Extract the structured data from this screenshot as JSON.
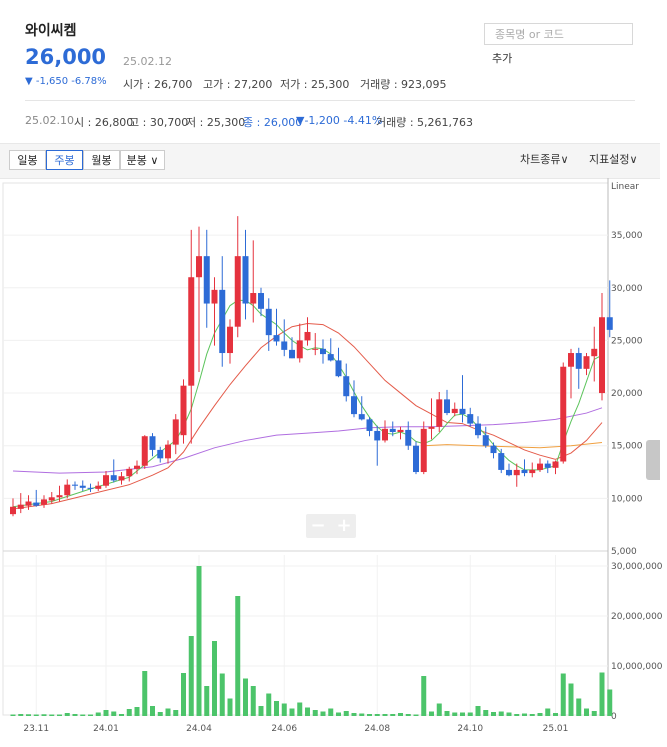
{
  "stock": {
    "name": "와이씨켐",
    "price": "26,000",
    "date": "25.02.12",
    "change": "▼ -1,650 -6.78%",
    "open": "시가 : 26,700",
    "high": "고가 : 27,200",
    "low": "저가 : 25,300",
    "volume": "거래량 : 923,095"
  },
  "search": {
    "placeholder": "종목명 or 코드",
    "add_label": "추가"
  },
  "prev_week": {
    "date": "25.02.10",
    "open": "시 : 26,800",
    "high": "고 : 30,700",
    "low": "저 : 25,300",
    "close": "종 : 26,000",
    "change": "▼-1,200 -4.41%",
    "volume": "거래량 : 5,261,763"
  },
  "toolbar": {
    "daily": "일봉",
    "weekly": "주봉",
    "monthly": "월봉",
    "minute": "분봉 ∨",
    "chart_type": "차트종류∨",
    "indicator": "지표설정∨"
  },
  "colors": {
    "up": "#e5323e",
    "down": "#2d6bd6",
    "volume": "#4cc46a",
    "ma5": "#5cc45c",
    "ma20": "#e45b4a",
    "ma60": "#f0a040",
    "ma120": "#b06ee0"
  },
  "chart_data": {
    "type": "candlestick",
    "scale_label": "Linear",
    "price_ticks": [
      5000,
      10000,
      15000,
      20000,
      25000,
      30000,
      35000
    ],
    "price_tick_labels": [
      "5,000",
      "10,000",
      "15,000",
      "20,000",
      "25,000",
      "30,000",
      "35,000"
    ],
    "volume_ticks": [
      0,
      10000000,
      20000000,
      30000000
    ],
    "volume_tick_labels": [
      "0",
      "10,000,000",
      "20,000,000",
      "30,000,000"
    ],
    "x_labels": [
      {
        "i": 3,
        "label": "23.11"
      },
      {
        "i": 12,
        "label": "24.01"
      },
      {
        "i": 24,
        "label": "24.04"
      },
      {
        "i": 35,
        "label": "24.06"
      },
      {
        "i": 47,
        "label": "24.08"
      },
      {
        "i": 59,
        "label": "24.10"
      },
      {
        "i": 70,
        "label": "25.01"
      }
    ],
    "candles": [
      {
        "o": 8500,
        "h": 10000,
        "l": 8300,
        "c": 9200,
        "v": 300000
      },
      {
        "o": 9000,
        "h": 10500,
        "l": 8600,
        "c": 9400,
        "v": 400000
      },
      {
        "o": 9300,
        "h": 10300,
        "l": 8900,
        "c": 9700,
        "v": 350000
      },
      {
        "o": 9600,
        "h": 10800,
        "l": 9200,
        "c": 9300,
        "v": 300000
      },
      {
        "o": 9400,
        "h": 10300,
        "l": 9100,
        "c": 9900,
        "v": 350000
      },
      {
        "o": 9800,
        "h": 10600,
        "l": 9500,
        "c": 10100,
        "v": 300000
      },
      {
        "o": 10100,
        "h": 11200,
        "l": 9700,
        "c": 10300,
        "v": 300000
      },
      {
        "o": 10300,
        "h": 11800,
        "l": 10000,
        "c": 11300,
        "v": 600000
      },
      {
        "o": 11300,
        "h": 11600,
        "l": 10800,
        "c": 11200,
        "v": 400000
      },
      {
        "o": 11200,
        "h": 11700,
        "l": 10700,
        "c": 11000,
        "v": 300000
      },
      {
        "o": 11000,
        "h": 11400,
        "l": 10600,
        "c": 10900,
        "v": 300000
      },
      {
        "o": 10900,
        "h": 11600,
        "l": 10700,
        "c": 11200,
        "v": 700000
      },
      {
        "o": 11200,
        "h": 12600,
        "l": 11000,
        "c": 12200,
        "v": 1200000
      },
      {
        "o": 12200,
        "h": 13700,
        "l": 11500,
        "c": 11700,
        "v": 900000
      },
      {
        "o": 11700,
        "h": 12500,
        "l": 11300,
        "c": 12100,
        "v": 400000
      },
      {
        "o": 12100,
        "h": 13000,
        "l": 11600,
        "c": 12800,
        "v": 1400000
      },
      {
        "o": 12800,
        "h": 13600,
        "l": 12300,
        "c": 13100,
        "v": 1800000
      },
      {
        "o": 13100,
        "h": 16000,
        "l": 12800,
        "c": 15900,
        "v": 9000000
      },
      {
        "o": 15900,
        "h": 16200,
        "l": 14000,
        "c": 14600,
        "v": 2000000
      },
      {
        "o": 14600,
        "h": 14900,
        "l": 13400,
        "c": 13800,
        "v": 800000
      },
      {
        "o": 13800,
        "h": 15500,
        "l": 13300,
        "c": 15100,
        "v": 1500000
      },
      {
        "o": 15100,
        "h": 18000,
        "l": 14200,
        "c": 17500,
        "v": 1200000
      },
      {
        "o": 16000,
        "h": 21300,
        "l": 15200,
        "c": 20700,
        "v": 8600000
      },
      {
        "o": 20700,
        "h": 35500,
        "l": 15200,
        "c": 31000,
        "v": 16000000
      },
      {
        "o": 31000,
        "h": 35800,
        "l": 22000,
        "c": 33000,
        "v": 30000000
      },
      {
        "o": 33000,
        "h": 35500,
        "l": 26200,
        "c": 28500,
        "v": 6000000
      },
      {
        "o": 28500,
        "h": 31000,
        "l": 24500,
        "c": 29800,
        "v": 15000000
      },
      {
        "o": 29800,
        "h": 33000,
        "l": 22500,
        "c": 23800,
        "v": 8500000
      },
      {
        "o": 23800,
        "h": 27000,
        "l": 22800,
        "c": 26300,
        "v": 3500000
      },
      {
        "o": 26300,
        "h": 36800,
        "l": 25300,
        "c": 33000,
        "v": 24000000
      },
      {
        "o": 33000,
        "h": 35500,
        "l": 27000,
        "c": 28500,
        "v": 7500000
      },
      {
        "o": 28500,
        "h": 34500,
        "l": 26700,
        "c": 29500,
        "v": 6000000
      },
      {
        "o": 29500,
        "h": 30000,
        "l": 27300,
        "c": 28000,
        "v": 2000000
      },
      {
        "o": 28000,
        "h": 29000,
        "l": 24000,
        "c": 25500,
        "v": 4500000
      },
      {
        "o": 25500,
        "h": 28000,
        "l": 24500,
        "c": 24900,
        "v": 3000000
      },
      {
        "o": 24900,
        "h": 27000,
        "l": 23500,
        "c": 24100,
        "v": 2500000
      },
      {
        "o": 24100,
        "h": 25300,
        "l": 23300,
        "c": 23300,
        "v": 1500000
      },
      {
        "o": 23300,
        "h": 26600,
        "l": 22900,
        "c": 25000,
        "v": 2700000
      },
      {
        "o": 25000,
        "h": 27200,
        "l": 24500,
        "c": 25800,
        "v": 1700000
      },
      {
        "o": 24200,
        "h": 25700,
        "l": 23600,
        "c": 24200,
        "v": 1200000
      },
      {
        "o": 24200,
        "h": 25100,
        "l": 22800,
        "c": 23700,
        "v": 900000
      },
      {
        "o": 23700,
        "h": 25200,
        "l": 23000,
        "c": 23100,
        "v": 1500000
      },
      {
        "o": 23100,
        "h": 24300,
        "l": 21500,
        "c": 21600,
        "v": 700000
      },
      {
        "o": 21600,
        "h": 22800,
        "l": 19200,
        "c": 19700,
        "v": 1000000
      },
      {
        "o": 19700,
        "h": 21200,
        "l": 17700,
        "c": 18000,
        "v": 600000
      },
      {
        "o": 18000,
        "h": 19700,
        "l": 17400,
        "c": 17500,
        "v": 500000
      },
      {
        "o": 17500,
        "h": 17700,
        "l": 15900,
        "c": 16400,
        "v": 400000
      },
      {
        "o": 16400,
        "h": 16900,
        "l": 13100,
        "c": 15500,
        "v": 400000
      },
      {
        "o": 15500,
        "h": 17400,
        "l": 15300,
        "c": 16600,
        "v": 400000
      },
      {
        "o": 16600,
        "h": 17300,
        "l": 15900,
        "c": 16300,
        "v": 400000
      },
      {
        "o": 16300,
        "h": 16800,
        "l": 15600,
        "c": 16500,
        "v": 600000
      },
      {
        "o": 16500,
        "h": 17300,
        "l": 14600,
        "c": 15000,
        "v": 400000
      },
      {
        "o": 15000,
        "h": 15400,
        "l": 12300,
        "c": 12500,
        "v": 300000
      },
      {
        "o": 12500,
        "h": 17300,
        "l": 12300,
        "c": 16600,
        "v": 8000000
      },
      {
        "o": 16600,
        "h": 19500,
        "l": 15600,
        "c": 16800,
        "v": 900000
      },
      {
        "o": 16800,
        "h": 20100,
        "l": 16300,
        "c": 19400,
        "v": 2500000
      },
      {
        "o": 19400,
        "h": 20300,
        "l": 17900,
        "c": 18100,
        "v": 1000000
      },
      {
        "o": 18100,
        "h": 19100,
        "l": 17800,
        "c": 18500,
        "v": 700000
      },
      {
        "o": 18500,
        "h": 21700,
        "l": 17200,
        "c": 18000,
        "v": 700000
      },
      {
        "o": 18000,
        "h": 18600,
        "l": 16800,
        "c": 17100,
        "v": 700000
      },
      {
        "o": 17100,
        "h": 17800,
        "l": 15700,
        "c": 16000,
        "v": 2000000
      },
      {
        "o": 16000,
        "h": 16800,
        "l": 14800,
        "c": 15000,
        "v": 1200000
      },
      {
        "o": 15000,
        "h": 15300,
        "l": 13800,
        "c": 14300,
        "v": 800000
      },
      {
        "o": 14300,
        "h": 14700,
        "l": 12400,
        "c": 12700,
        "v": 900000
      },
      {
        "o": 12700,
        "h": 13300,
        "l": 12100,
        "c": 12200,
        "v": 700000
      },
      {
        "o": 12200,
        "h": 13300,
        "l": 11100,
        "c": 12700,
        "v": 400000
      },
      {
        "o": 12700,
        "h": 13700,
        "l": 12100,
        "c": 12400,
        "v": 500000
      },
      {
        "o": 12400,
        "h": 13400,
        "l": 12000,
        "c": 12700,
        "v": 400000
      },
      {
        "o": 12700,
        "h": 13800,
        "l": 12500,
        "c": 13300,
        "v": 600000
      },
      {
        "o": 13300,
        "h": 13600,
        "l": 12400,
        "c": 12900,
        "v": 1500000
      },
      {
        "o": 12900,
        "h": 13600,
        "l": 12300,
        "c": 13500,
        "v": 600000
      },
      {
        "o": 13500,
        "h": 22900,
        "l": 13300,
        "c": 22500,
        "v": 8500000
      },
      {
        "o": 22500,
        "h": 24200,
        "l": 19500,
        "c": 23800,
        "v": 6500000
      },
      {
        "o": 23800,
        "h": 24300,
        "l": 20400,
        "c": 22300,
        "v": 3500000
      },
      {
        "o": 22300,
        "h": 23800,
        "l": 21700,
        "c": 23500,
        "v": 1500000
      },
      {
        "o": 23500,
        "h": 26300,
        "l": 21100,
        "c": 24200,
        "v": 1000000
      },
      {
        "o": 20000,
        "h": 29500,
        "l": 19300,
        "c": 27200,
        "v": 8700000
      },
      {
        "o": 27200,
        "h": 30700,
        "l": 25300,
        "c": 26000,
        "v": 5300000
      }
    ],
    "ma5": [
      [
        0,
        9200
      ],
      [
        5,
        9700
      ],
      [
        10,
        10900
      ],
      [
        15,
        12000
      ],
      [
        19,
        14400
      ],
      [
        21,
        15500
      ],
      [
        22,
        16800
      ],
      [
        23,
        18500
      ],
      [
        24,
        21000
      ],
      [
        25,
        23700
      ],
      [
        26,
        25700
      ],
      [
        27,
        27000
      ],
      [
        28,
        28300
      ],
      [
        29,
        28800
      ],
      [
        30,
        28800
      ],
      [
        31,
        28300
      ],
      [
        32,
        27500
      ],
      [
        33,
        27000
      ],
      [
        34,
        26500
      ],
      [
        35,
        25700
      ],
      [
        36,
        25000
      ],
      [
        37,
        24500
      ],
      [
        38,
        24100
      ],
      [
        39,
        24300
      ],
      [
        40,
        24200
      ],
      [
        41,
        23700
      ],
      [
        42,
        22700
      ],
      [
        43,
        21500
      ],
      [
        44,
        20100
      ],
      [
        45,
        18800
      ],
      [
        46,
        17700
      ],
      [
        47,
        16800
      ],
      [
        48,
        16200
      ],
      [
        49,
        16100
      ],
      [
        50,
        16300
      ],
      [
        51,
        16000
      ],
      [
        52,
        15400
      ],
      [
        53,
        15200
      ],
      [
        54,
        15500
      ],
      [
        55,
        16200
      ],
      [
        56,
        17100
      ],
      [
        57,
        17900
      ],
      [
        58,
        18000
      ],
      [
        59,
        17600
      ],
      [
        60,
        16800
      ],
      [
        61,
        16000
      ],
      [
        62,
        15100
      ],
      [
        63,
        14300
      ],
      [
        64,
        13600
      ],
      [
        65,
        13100
      ],
      [
        66,
        12700
      ],
      [
        67,
        12700
      ],
      [
        68,
        12700
      ],
      [
        69,
        12900
      ],
      [
        70,
        13100
      ],
      [
        71,
        15300
      ],
      [
        72,
        17300
      ],
      [
        73,
        19000
      ],
      [
        74,
        21100
      ],
      [
        75,
        23200
      ],
      [
        76,
        23600
      ]
    ],
    "ma20": [
      [
        0,
        9000
      ],
      [
        5,
        9500
      ],
      [
        10,
        10400
      ],
      [
        15,
        11300
      ],
      [
        18,
        12200
      ],
      [
        20,
        12900
      ],
      [
        22,
        14400
      ],
      [
        24,
        16700
      ],
      [
        26,
        18800
      ],
      [
        28,
        20800
      ],
      [
        30,
        22600
      ],
      [
        32,
        24300
      ],
      [
        34,
        25400
      ],
      [
        36,
        26300
      ],
      [
        38,
        26600
      ],
      [
        40,
        26500
      ],
      [
        42,
        25700
      ],
      [
        44,
        24400
      ],
      [
        46,
        22800
      ],
      [
        48,
        21200
      ],
      [
        50,
        20000
      ],
      [
        52,
        18800
      ],
      [
        54,
        18000
      ],
      [
        56,
        17200
      ],
      [
        58,
        17100
      ],
      [
        60,
        16500
      ],
      [
        62,
        16000
      ],
      [
        64,
        15300
      ],
      [
        66,
        14600
      ],
      [
        68,
        14100
      ],
      [
        70,
        13700
      ],
      [
        72,
        14300
      ],
      [
        74,
        15500
      ],
      [
        76,
        17200
      ]
    ],
    "ma60": [
      [
        53,
        15000
      ],
      [
        56,
        15100
      ],
      [
        60,
        15000
      ],
      [
        64,
        14900
      ],
      [
        68,
        14800
      ],
      [
        72,
        15000
      ],
      [
        76,
        15300
      ]
    ],
    "ma120": [
      [
        0,
        12600
      ],
      [
        6,
        12400
      ],
      [
        12,
        12500
      ],
      [
        18,
        13000
      ],
      [
        22,
        13800
      ],
      [
        26,
        14800
      ],
      [
        30,
        15500
      ],
      [
        34,
        16000
      ],
      [
        38,
        16200
      ],
      [
        42,
        16400
      ],
      [
        46,
        16700
      ],
      [
        50,
        16800
      ],
      [
        54,
        16800
      ],
      [
        58,
        16900
      ],
      [
        62,
        17000
      ],
      [
        66,
        17200
      ],
      [
        70,
        17500
      ],
      [
        74,
        18100
      ],
      [
        76,
        18600
      ]
    ]
  }
}
